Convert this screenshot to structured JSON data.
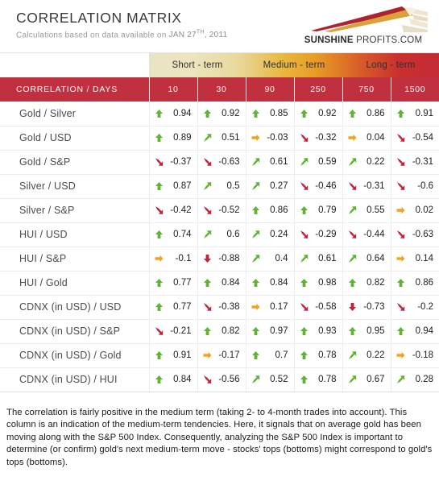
{
  "header": {
    "title": "CORRELATION MATRIX",
    "subtitle_prefix": "Calculations based on data available on",
    "date_month_day": "JAN 27",
    "date_ordinal": "TH",
    "date_year": ", 2011",
    "logo_brand": "SUNSHINE",
    "logo_suffix": " PROFITS.COM"
  },
  "table": {
    "terms": [
      "Short - term",
      "Medium - term",
      "Long - term"
    ],
    "corner_label": "CORRELATION / DAYS",
    "day_columns": [
      "10",
      "30",
      "90",
      "250",
      "750",
      "1500"
    ],
    "rows": [
      {
        "label": "Gold / Silver",
        "cells": [
          {
            "value": "0.94",
            "trend": "up"
          },
          {
            "value": "0.92",
            "trend": "up"
          },
          {
            "value": "0.85",
            "trend": "up"
          },
          {
            "value": "0.92",
            "trend": "up"
          },
          {
            "value": "0.86",
            "trend": "up"
          },
          {
            "value": "0.91",
            "trend": "up"
          }
        ]
      },
      {
        "label": "Gold / USD",
        "cells": [
          {
            "value": "0.89",
            "trend": "up"
          },
          {
            "value": "0.51",
            "trend": "up-right"
          },
          {
            "value": "-0.03",
            "trend": "flat"
          },
          {
            "value": "-0.32",
            "trend": "down-right"
          },
          {
            "value": "0.04",
            "trend": "flat"
          },
          {
            "value": "-0.54",
            "trend": "down-right"
          }
        ]
      },
      {
        "label": "Gold / S&P",
        "cells": [
          {
            "value": "-0.37",
            "trend": "down-right"
          },
          {
            "value": "-0.63",
            "trend": "down-right"
          },
          {
            "value": "0.61",
            "trend": "up-right"
          },
          {
            "value": "0.59",
            "trend": "up-right"
          },
          {
            "value": "0.22",
            "trend": "up-right"
          },
          {
            "value": "-0.31",
            "trend": "down-right"
          }
        ]
      },
      {
        "label": "Silver / USD",
        "cells": [
          {
            "value": "0.87",
            "trend": "up"
          },
          {
            "value": "0.5",
            "trend": "up-right"
          },
          {
            "value": "0.27",
            "trend": "up-right"
          },
          {
            "value": "-0.46",
            "trend": "down-right"
          },
          {
            "value": "-0.31",
            "trend": "down-right"
          },
          {
            "value": "-0.6",
            "trend": "down-right"
          }
        ]
      },
      {
        "label": "Silver / S&P",
        "cells": [
          {
            "value": "-0.42",
            "trend": "down-right"
          },
          {
            "value": "-0.52",
            "trend": "down-right"
          },
          {
            "value": "0.86",
            "trend": "up"
          },
          {
            "value": "0.79",
            "trend": "up"
          },
          {
            "value": "0.55",
            "trend": "up-right"
          },
          {
            "value": "0.02",
            "trend": "flat"
          }
        ]
      },
      {
        "label": "HUI / USD",
        "cells": [
          {
            "value": "0.74",
            "trend": "up"
          },
          {
            "value": "0.6",
            "trend": "up-right"
          },
          {
            "value": "0.24",
            "trend": "up-right"
          },
          {
            "value": "-0.29",
            "trend": "down-right"
          },
          {
            "value": "-0.44",
            "trend": "down-right"
          },
          {
            "value": "-0.63",
            "trend": "down-right"
          }
        ]
      },
      {
        "label": "HUI / S&P",
        "cells": [
          {
            "value": "-0.1",
            "trend": "flat"
          },
          {
            "value": "-0.88",
            "trend": "down"
          },
          {
            "value": "0.4",
            "trend": "up-right"
          },
          {
            "value": "0.61",
            "trend": "up-right"
          },
          {
            "value": "0.64",
            "trend": "up-right"
          },
          {
            "value": "0.14",
            "trend": "flat"
          }
        ]
      },
      {
        "label": "HUI / Gold",
        "cells": [
          {
            "value": "0.77",
            "trend": "up"
          },
          {
            "value": "0.84",
            "trend": "up"
          },
          {
            "value": "0.84",
            "trend": "up"
          },
          {
            "value": "0.98",
            "trend": "up"
          },
          {
            "value": "0.82",
            "trend": "up"
          },
          {
            "value": "0.86",
            "trend": "up"
          }
        ]
      },
      {
        "label": "CDNX (in USD) / USD",
        "cells": [
          {
            "value": "0.77",
            "trend": "up"
          },
          {
            "value": "-0.38",
            "trend": "down-right"
          },
          {
            "value": "0.17",
            "trend": "flat"
          },
          {
            "value": "-0.58",
            "trend": "down-right"
          },
          {
            "value": "-0.73",
            "trend": "down"
          },
          {
            "value": "-0.2",
            "trend": "down-right"
          }
        ]
      },
      {
        "label": "CDNX (in USD) / S&P",
        "cells": [
          {
            "value": "-0.21",
            "trend": "down-right"
          },
          {
            "value": "0.82",
            "trend": "up"
          },
          {
            "value": "0.97",
            "trend": "up"
          },
          {
            "value": "0.93",
            "trend": "up"
          },
          {
            "value": "0.95",
            "trend": "up"
          },
          {
            "value": "0.94",
            "trend": "up"
          }
        ]
      },
      {
        "label": "CDNX (in USD) / Gold",
        "cells": [
          {
            "value": "0.91",
            "trend": "up"
          },
          {
            "value": "-0.17",
            "trend": "flat"
          },
          {
            "value": "0.7",
            "trend": "up"
          },
          {
            "value": "0.78",
            "trend": "up"
          },
          {
            "value": "0.22",
            "trend": "up-right"
          },
          {
            "value": "-0.18",
            "trend": "flat"
          }
        ]
      },
      {
        "label": "CDNX (in USD) / HUI",
        "cells": [
          {
            "value": "0.84",
            "trend": "up"
          },
          {
            "value": "-0.56",
            "trend": "down-right"
          },
          {
            "value": "0.52",
            "trend": "up-right"
          },
          {
            "value": "0.78",
            "trend": "up"
          },
          {
            "value": "0.67",
            "trend": "up-right"
          },
          {
            "value": "0.28",
            "trend": "up-right"
          }
        ]
      }
    ]
  },
  "footer": {
    "text": "The correlation is fairly positive in the medium term (taking 2- to 4-month trades into account). This column is an indication of the medium-term tendencies. Here, it signals that on average gold has been moving along with the S&P 500 Index. Consequently, analyzing the S&P 500 Index is important to determine (or confirm) gold's next medium-term move - stocks' tops (bottoms) might correspond to gold's tops (bottoms)."
  },
  "colors": {
    "header_red": "#c0303f",
    "positive_green": "#5fb233",
    "neutral_orange": "#f0a31e",
    "negative_red": "#c3213b",
    "gradient_start": "#e8e3c4",
    "gradient_mid": "#e9b63c",
    "gradient_end": "#c32b36"
  }
}
